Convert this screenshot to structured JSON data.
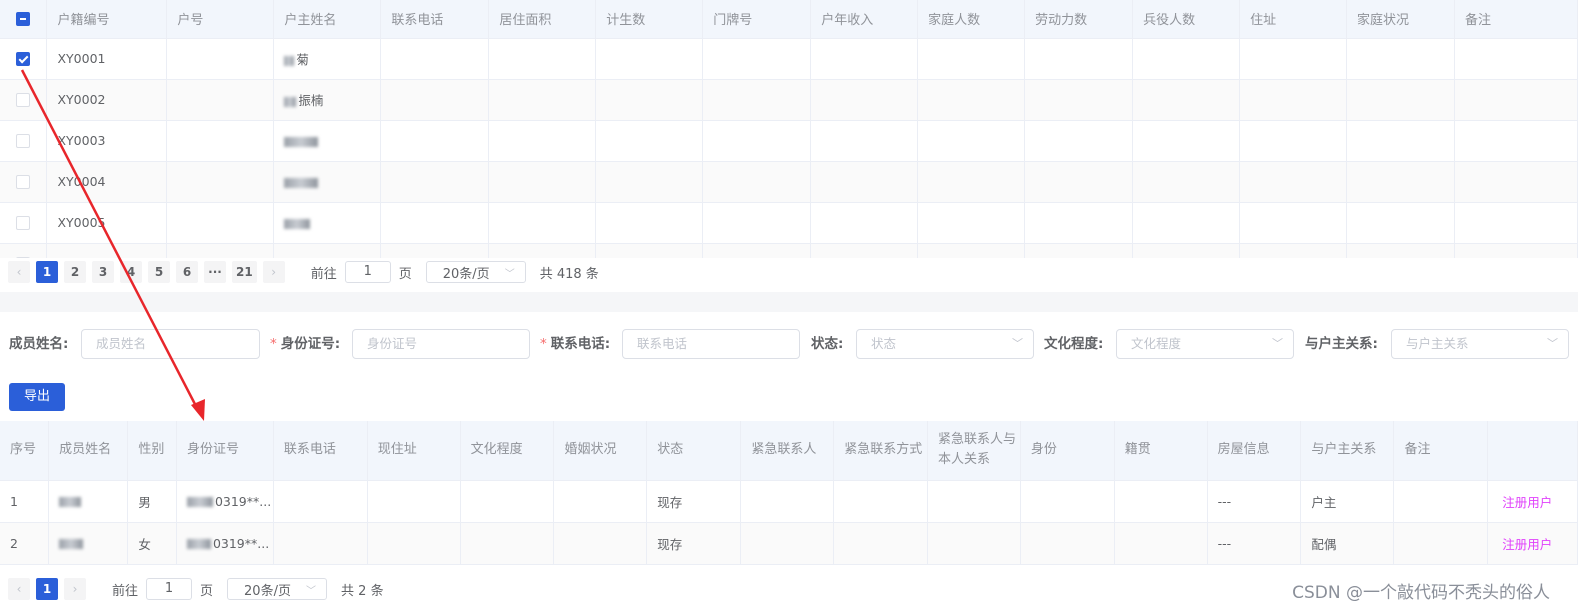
{
  "top_table": {
    "columns": [
      "户籍编号",
      "户号",
      "户主姓名",
      "联系电话",
      "居住面积",
      "计生数",
      "门牌号",
      "户年收入",
      "家庭人数",
      "劳动力数",
      "兵役人数",
      "住址",
      "家庭状况",
      "备注"
    ],
    "rows": [
      {
        "id": "XY0001",
        "name_visible": "菊",
        "checked": true
      },
      {
        "id": "XY0002",
        "name_visible": "振楠",
        "checked": false
      },
      {
        "id": "XY0003",
        "name_visible": "",
        "checked": false
      },
      {
        "id": "XY0004",
        "name_visible": "",
        "checked": false
      },
      {
        "id": "XY0005",
        "name_visible": "",
        "checked": false
      },
      {
        "id": "",
        "name_visible": "",
        "checked": false
      }
    ]
  },
  "top_pager": {
    "pages": [
      "1",
      "2",
      "3",
      "4",
      "5",
      "6",
      "···",
      "21"
    ],
    "prev": "‹",
    "next": "›",
    "goto_label": "前往",
    "current_page": "1",
    "page_unit": "页",
    "page_size": "20条/页",
    "total": "共 418 条"
  },
  "search_form": {
    "member_name_label": "成员姓名:",
    "member_name_placeholder": "成员姓名",
    "id_label": "身份证号:",
    "id_placeholder": "身份证号",
    "phone_label": "联系电话:",
    "phone_placeholder": "联系电话",
    "status_label": "状态:",
    "status_placeholder": "状态",
    "education_label": "文化程度:",
    "education_placeholder": "文化程度",
    "relation_label": "与户主关系:",
    "relation_placeholder": "与户主关系",
    "required_mark": "*"
  },
  "export_label": "导出",
  "bottom_table": {
    "columns": [
      "序号",
      "成员姓名",
      "性别",
      "身份证号",
      "联系电话",
      "现住址",
      "文化程度",
      "婚姻状况",
      "状态",
      "紧急联系人",
      "紧急联系方式",
      "紧急联系人与本人关系",
      "身份",
      "籍贯",
      "房屋信息",
      "与户主关系",
      "备注",
      ""
    ],
    "rows": [
      {
        "no": "1",
        "gender": "男",
        "id_no": "0319**...",
        "status": "现存",
        "house": "---",
        "relation": "户主",
        "action": "注册用户"
      },
      {
        "no": "2",
        "gender": "女",
        "id_no": "0319**...",
        "status": "现存",
        "house": "---",
        "relation": "配偶",
        "action": "注册用户"
      }
    ]
  },
  "bottom_pager": {
    "prev": "‹",
    "next": "›",
    "current": "1",
    "goto_label": "前往",
    "current_page": "1",
    "page_unit": "页",
    "page_size": "20条/页",
    "total": "共 2 条"
  },
  "watermark": "CSDN @一个敲代码不秃头的俗人",
  "colors": {
    "primary": "#2b5fd9",
    "link": "#e040fb",
    "arrow": "#e8262b",
    "required": "#f56c6c"
  }
}
